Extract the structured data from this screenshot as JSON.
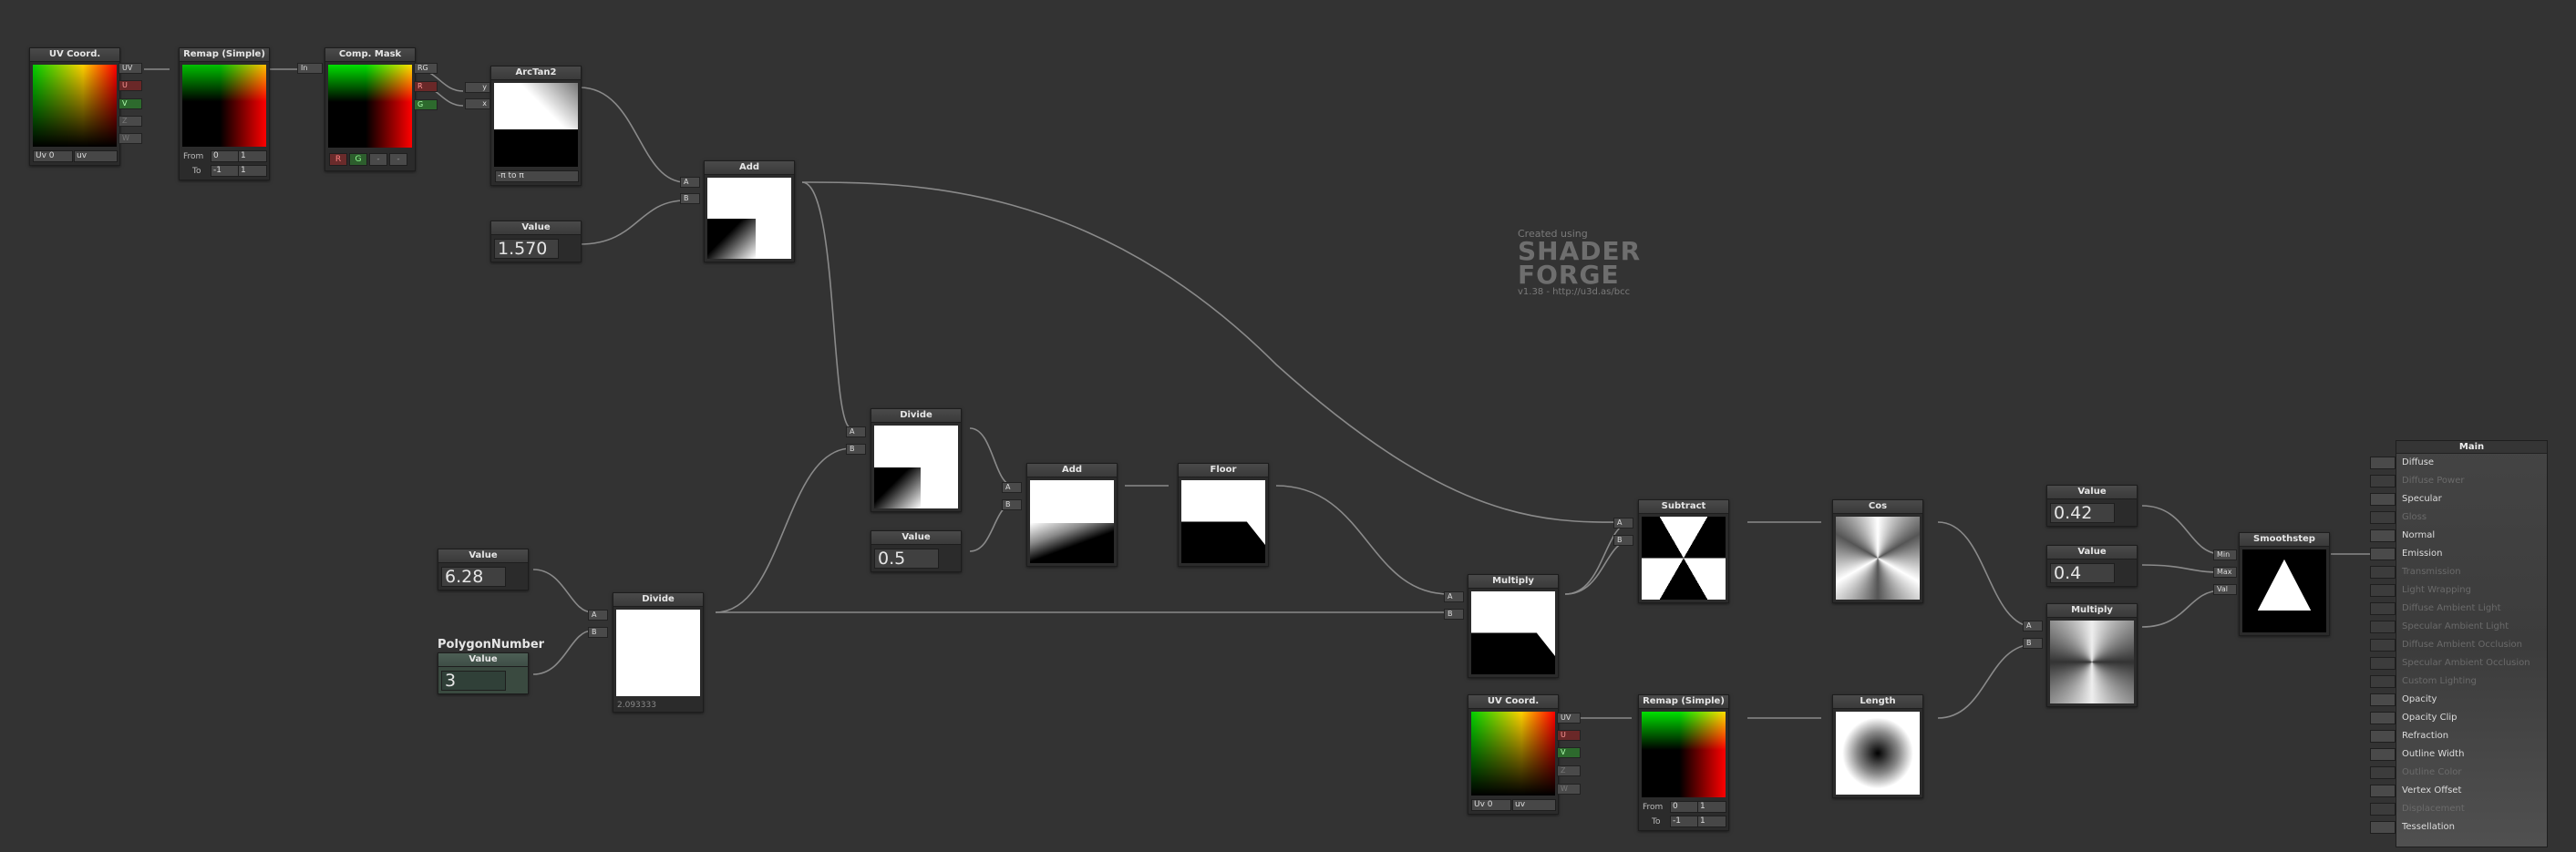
{
  "watermark": {
    "line1": "Created using",
    "line2a": "SHADER",
    "line2b": "FORGE",
    "line3": "v1.38 - http://u3d.as/bcc"
  },
  "nodes": {
    "uv1": {
      "title": "UV Coord.",
      "ports": [
        "UV",
        "U",
        "V",
        "Z",
        "W"
      ],
      "f1": "Uv 0",
      "f2": "uv"
    },
    "remap1": {
      "title": "Remap (Simple)",
      "from_label": "From",
      "from_a": "0",
      "from_b": "1",
      "to_label": "To",
      "to_a": "-1",
      "to_b": "1",
      "in_label": "In"
    },
    "mask": {
      "title": "Comp. Mask",
      "out_rg": "RG",
      "out_r": "R",
      "out_g": "G",
      "btn_r": "R",
      "btn_g": "G",
      "btn_n1": "-",
      "btn_n2": "-"
    },
    "atan": {
      "title": "ArcTan2",
      "in_y": "y",
      "in_x": "x",
      "mode": "-π to π"
    },
    "val1": {
      "title": "Value",
      "value": "1.570"
    },
    "add1": {
      "title": "Add",
      "a": "A",
      "b": "B"
    },
    "divide1": {
      "title": "Divide",
      "a": "A",
      "b": "B"
    },
    "val2": {
      "title": "Value",
      "value": "0.5"
    },
    "add2": {
      "title": "Add",
      "a": "A",
      "b": "B"
    },
    "floor": {
      "title": "Floor"
    },
    "val3": {
      "title": "Value",
      "value": "6.28"
    },
    "poly": {
      "label": "PolygonNumber",
      "title": "Value",
      "value": "3"
    },
    "divide2": {
      "title": "Divide",
      "a": "A",
      "b": "B",
      "footer": "2.093333"
    },
    "mult1": {
      "title": "Multiply",
      "a": "A",
      "b": "B"
    },
    "subtract": {
      "title": "Subtract",
      "a": "A",
      "b": "B"
    },
    "cos": {
      "title": "Cos"
    },
    "uv2": {
      "title": "UV Coord.",
      "ports": [
        "UV",
        "U",
        "V",
        "Z",
        "W"
      ],
      "f1": "Uv 0",
      "f2": "uv"
    },
    "remap2": {
      "title": "Remap (Simple)",
      "from_label": "From",
      "from_a": "0",
      "from_b": "1",
      "to_label": "To",
      "to_a": "-1",
      "to_b": "1"
    },
    "length": {
      "title": "Length"
    },
    "val4": {
      "title": "Value",
      "value": "0.42"
    },
    "val5": {
      "title": "Value",
      "value": "0.4"
    },
    "mult2": {
      "title": "Multiply",
      "a": "A",
      "b": "B"
    },
    "smooth": {
      "title": "Smoothstep",
      "min": "Min",
      "max": "Max",
      "val": "Val"
    }
  },
  "main_panel": {
    "title": "Main",
    "inputs": [
      {
        "label": "Diffuse",
        "enabled": true
      },
      {
        "label": "Diffuse Power",
        "enabled": false
      },
      {
        "label": "Specular",
        "enabled": true
      },
      {
        "label": "Gloss",
        "enabled": false
      },
      {
        "label": "Normal",
        "enabled": true
      },
      {
        "label": "Emission",
        "enabled": true
      },
      {
        "label": "Transmission",
        "enabled": false
      },
      {
        "label": "Light Wrapping",
        "enabled": false
      },
      {
        "label": "Diffuse Ambient Light",
        "enabled": false
      },
      {
        "label": "Specular Ambient Light",
        "enabled": false
      },
      {
        "label": "Diffuse Ambient Occlusion",
        "enabled": false
      },
      {
        "label": "Specular Ambient Occlusion",
        "enabled": false
      },
      {
        "label": "Custom Lighting",
        "enabled": false
      },
      {
        "label": "Opacity",
        "enabled": true
      },
      {
        "label": "Opacity Clip",
        "enabled": true
      },
      {
        "label": "Refraction",
        "enabled": true
      },
      {
        "label": "Outline Width",
        "enabled": true
      },
      {
        "label": "Outline Color",
        "enabled": false
      },
      {
        "label": "Vertex Offset",
        "enabled": true
      },
      {
        "label": "Displacement",
        "enabled": false
      },
      {
        "label": "Tessellation",
        "enabled": true
      }
    ]
  }
}
